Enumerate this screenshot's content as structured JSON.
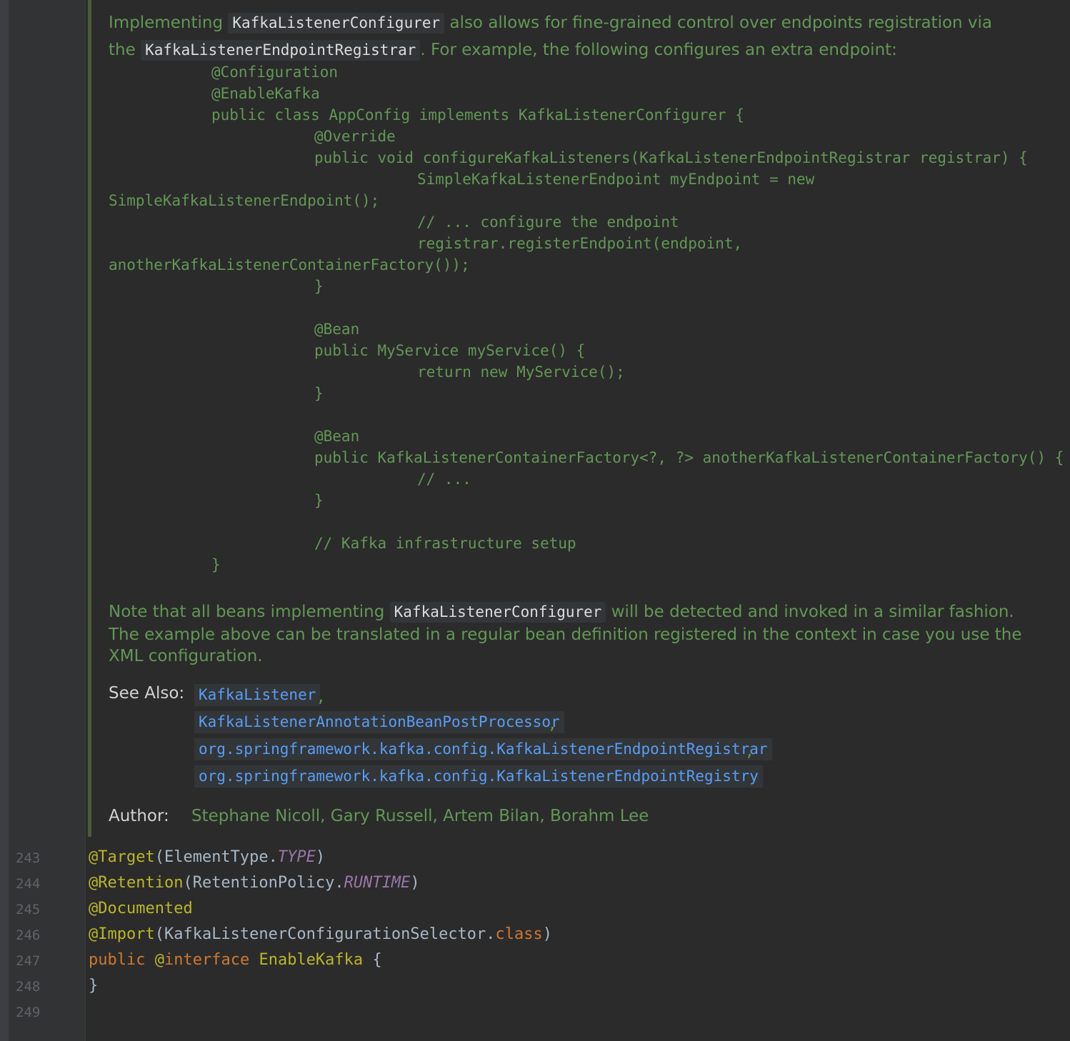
{
  "doc": {
    "intro_p1": "Implementing",
    "intro_chip1": "KafkaListenerConfigurer",
    "intro_p2": "also allows for fine-grained control over endpoints registration via",
    "intro_p3": "the",
    "intro_chip2": "KafkaListenerEndpointRegistrar",
    "intro_p4": ". For example, the following configures an extra endpoint:",
    "code_lines": [
      "@Configuration",
      "@EnableKafka",
      "public class AppConfig implements KafkaListenerConfigurer {",
      "@Override",
      "public void configureKafkaListeners(KafkaListenerEndpointRegistrar registrar) {",
      "SimpleKafkaListenerEndpoint myEndpoint = new",
      "SimpleKafkaListenerEndpoint();",
      "// ... configure the endpoint",
      "registrar.registerEndpoint(endpoint,",
      "anotherKafkaListenerContainerFactory());",
      "}",
      "@Bean",
      "public MyService myService() {",
      "return new MyService();",
      "}",
      "@Bean",
      "public KafkaListenerContainerFactory<?, ?> anotherKafkaListenerContainerFactory() {",
      "// ...",
      "}",
      "// Kafka infrastructure setup",
      "}"
    ],
    "note_p1": "Note that all beans implementing",
    "note_chip": "KafkaListenerConfigurer",
    "note_p2": "will be detected and invoked in a similar fashion.",
    "note_line2": "The example above can be translated in a regular bean definition registered in the context in case you use the",
    "note_line3": "XML configuration.",
    "see_also_label": "See Also:",
    "see_also_links": [
      "KafkaListener",
      "KafkaListenerAnnotationBeanPostProcessor",
      "org.springframework.kafka.config.KafkaListenerEndpointRegistrar",
      "org.springframework.kafka.config.KafkaListenerEndpointRegistry"
    ],
    "comma": ",",
    "author_label": "Author:",
    "authors": "Stephane Nicoll, Gary Russell, Artem Bilan, Borahm Lee"
  },
  "source": {
    "line_numbers": [
      "243",
      "244",
      "245",
      "246",
      "247",
      "248",
      "249"
    ],
    "l243": {
      "ann": "@Target",
      "p1": "(ElementType.",
      "const": "TYPE",
      "p2": ")"
    },
    "l244": {
      "ann": "@Retention",
      "p1": "(RetentionPolicy.",
      "const": "RUNTIME",
      "p2": ")"
    },
    "l245": {
      "ann": "@Documented"
    },
    "l246": {
      "ann": "@Import",
      "p1": "(KafkaListenerConfigurationSelector.",
      "kw": "class",
      "p2": ")"
    },
    "l247": {
      "kw1": "public",
      "at": "@",
      "kw2": "interface",
      "name": "EnableKafka",
      "brace": " {"
    },
    "l248": {
      "brace": "}"
    }
  },
  "colors": {
    "background": "#2b2b2b",
    "doc_text": "#629755",
    "link": "#589df6",
    "annotation": "#bbb529",
    "keyword": "#cc7832",
    "constant": "#9876aa",
    "plain": "#a9b7c6"
  }
}
